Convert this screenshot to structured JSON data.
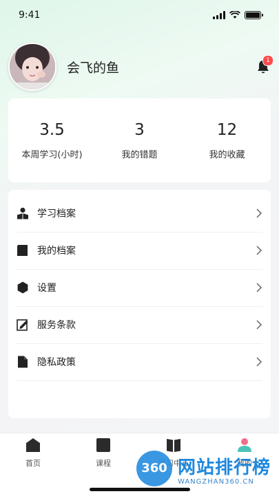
{
  "status_bar": {
    "time": "9:41"
  },
  "profile": {
    "username": "会飞的鱼",
    "notification_count": "1"
  },
  "stats": [
    {
      "value": "3.5",
      "label": "本周学习(小时)"
    },
    {
      "value": "3",
      "label": "我的错题"
    },
    {
      "value": "12",
      "label": "我的收藏"
    }
  ],
  "menu": [
    {
      "label": "学习档案",
      "icon": "person-icon"
    },
    {
      "label": "我的档案",
      "icon": "folder-icon"
    },
    {
      "label": "设置",
      "icon": "hexagon-icon"
    },
    {
      "label": "服务条款",
      "icon": "edit-document-icon"
    },
    {
      "label": "隐私政策",
      "icon": "document-icon"
    }
  ],
  "tabbar": [
    {
      "label": "首页",
      "icon": "home-icon"
    },
    {
      "label": "课程",
      "icon": "course-icon"
    },
    {
      "label": "学习中心",
      "icon": "book-icon"
    },
    {
      "label": "我的",
      "icon": "profile-icon",
      "active": true
    }
  ],
  "watermark": {
    "badge": "360",
    "title": "网站排行榜",
    "subtitle": "WANGZHAN360.CN"
  }
}
